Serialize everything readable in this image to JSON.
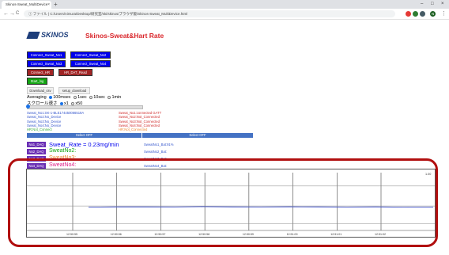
{
  "browser": {
    "tab_title": "Skinos-Sweat_MultiDevice",
    "tab_close": "×",
    "new_tab": "+",
    "window_controls": [
      "–",
      "□",
      "×"
    ],
    "nav": [
      "←",
      "→",
      "C",
      "ⓘ"
    ],
    "url": "ファイル  |  C:/Users/nimura/Desktop/研究室/ski/skinos/ブラウザ版/Skinos-Sweat_MultiDevice.html",
    "ext_colors": [
      "#e53935",
      "#2e7d32",
      "#455a64",
      "#1b5e20"
    ],
    "profile_initial": "N",
    "menu": "⋮"
  },
  "header": {
    "logo_text": "SKINOS",
    "title": "Skinos-Sweat&Hart Rate"
  },
  "buttons": {
    "connect1": "Connect_Sweat_No1",
    "connect2": "Connect_Sweat_No2",
    "connect3": "Connect_Sweat_No3",
    "connect4": "Connect_Sweat_No4",
    "connect_hr": "Connect_HR",
    "hr_dat_read": "HR_DAT_Read",
    "start_log": "Start_log",
    "download_csv": "Download_csv",
    "setup_download": "setup_download"
  },
  "averaging": {
    "label": "Averaging",
    "options": [
      "100msec",
      "1sec",
      "10sec",
      "1min"
    ],
    "selected": "100msec"
  },
  "scroll": {
    "label": "スクロール速さ",
    "options": [
      "x1",
      "x50"
    ],
    "selected": "x1"
  },
  "status": {
    "left": [
      {
        "text": "Sweat_No1:SK-1-BLE174450066519A",
        "color": "#3355cc"
      },
      {
        "text": "Sweat_No2:No_Device",
        "color": "#3355cc"
      },
      {
        "text": "Sweat_No3:No_Device",
        "color": "#3355cc"
      },
      {
        "text": "Sweat_No4:No_Device",
        "color": "#3355cc"
      },
      {
        "text": "HR:Not_Connect",
        "color": "#33aa33"
      }
    ],
    "right": [
      {
        "text": "Sweat_No1:connected GATT",
        "color": "#d02a2a"
      },
      {
        "text": "Sweat_No2:Not_Connected",
        "color": "#d02a2a"
      },
      {
        "text": "Sweat_No3:Not_Connected",
        "color": "#d02a2a"
      },
      {
        "text": "Sweat_No4:Not_Connected",
        "color": "#d02a2a"
      },
      {
        "text": "HR:Not_Connected",
        "color": "#ee8833"
      }
    ]
  },
  "select_bars": {
    "left": "Select OFF",
    "right": "Select OFF"
  },
  "devices": [
    {
      "daq": "No1_DAQ",
      "label": "Sweat_Rate = 0.23mg/min",
      "label_color": "#0000ee",
      "batt": "SweatNo1_Bat:91%"
    },
    {
      "daq": "No2_DAQ",
      "label": "SweatNo2:",
      "label_color": "#12a512",
      "batt": "SweatNo2_Bat:"
    },
    {
      "daq": "No3_DAQ",
      "label": "SweatNo3:",
      "label_color": "#ee8833",
      "batt": "SweatNo3_Bat:"
    },
    {
      "daq": "No4_DAQ",
      "label": "SweatNo4:",
      "label_color": "#e0218a",
      "batt": "SweatNo4_Bat:"
    }
  ],
  "chart_data": {
    "type": "line",
    "y_top_label": "1.00",
    "x_tick_labels": [
      "12:50:55",
      "12:50:56",
      "12:50:57",
      "12:50:58",
      "12:50:59",
      "12:51:00",
      "12:51:01",
      "12:51:02"
    ],
    "series": [
      {
        "color": "#4455cc",
        "values": [
          0.225,
          0.23,
          0.23,
          0.228,
          0.235,
          0.23,
          0.228,
          0.232,
          0.23,
          0.226,
          0.23,
          0.224,
          0.226
        ]
      }
    ],
    "ylim": [
      -0.3,
      1.0
    ],
    "grid": true
  }
}
